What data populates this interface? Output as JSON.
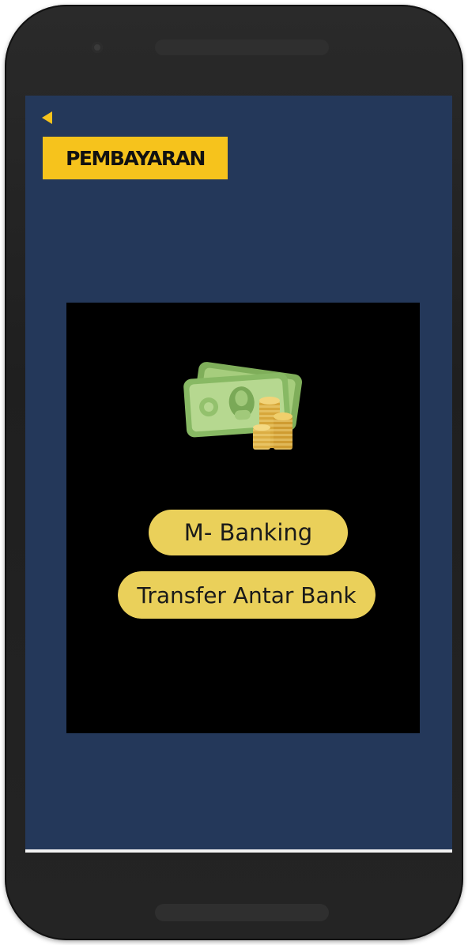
{
  "app": {
    "title": "PEMBAYARAN"
  },
  "nav": {
    "back_icon": "back-arrow-icon"
  },
  "panel": {
    "image_icon": "money-coins-icon",
    "options": [
      {
        "label": "M- Banking"
      },
      {
        "label": "Transfer Antar Bank"
      }
    ]
  },
  "colors": {
    "screen_bg": "#24385a",
    "title_bg": "#f6c31c",
    "button_bg": "#ead05a",
    "panel_bg": "#000000"
  }
}
